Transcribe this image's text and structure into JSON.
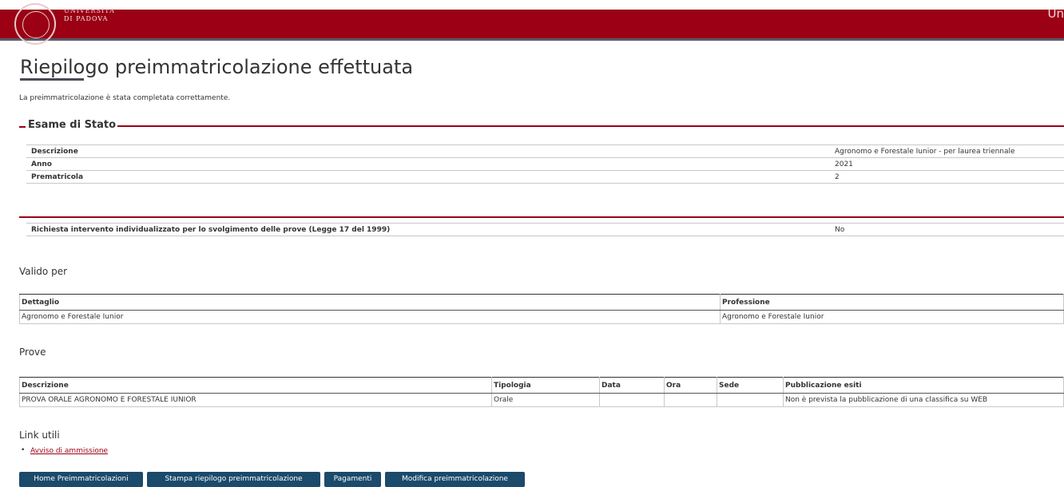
{
  "header": {
    "logo_line1": "UNIVERSITÀ",
    "logo_line2": "DI PADOVA",
    "right_text": "Un"
  },
  "page": {
    "title": "Riepilogo preimmatricolazione effettuata",
    "intro": "La preimmatricolazione è stata completata correttamente."
  },
  "esame": {
    "legend": "Esame di Stato",
    "rows": [
      {
        "label": "Descrizione",
        "value": "Agronomo e Forestale Iunior - per laurea triennale"
      },
      {
        "label": "Anno",
        "value": "2021"
      },
      {
        "label": "Prematricola",
        "value": "2"
      }
    ]
  },
  "richiesta": {
    "label": "Richiesta intervento individualizzato per lo svolgimento delle prove (Legge 17 del 1999)",
    "value": "No"
  },
  "valido": {
    "heading": "Valido per",
    "columns": [
      "Dettaglio",
      "Professione"
    ],
    "rows": [
      [
        "Agronomo e Forestale Iunior",
        "Agronomo e Forestale Iunior"
      ]
    ]
  },
  "prove": {
    "heading": "Prove",
    "columns": [
      "Descrizione",
      "Tipologia",
      "Data",
      "Ora",
      "Sede",
      "Pubblicazione esiti"
    ],
    "rows": [
      [
        "PROVA ORALE AGRONOMO E FORESTALE IUNIOR",
        "Orale",
        "",
        "",
        "",
        "Non è prevista la pubblicazione di una classifica su WEB"
      ]
    ]
  },
  "links": {
    "heading": "Link utili",
    "items": [
      "Avviso di ammissione"
    ]
  },
  "buttons": {
    "home": "Home Preimmatricolazioni",
    "stampa": "Stampa riepilogo preimmatricolazione",
    "pagamenti": "Pagamenti",
    "modifica": "Modifica preimmatricolazione"
  },
  "colors": {
    "brand": "#9b0014",
    "button": "#1b4a6b",
    "link": "#9b0014"
  }
}
